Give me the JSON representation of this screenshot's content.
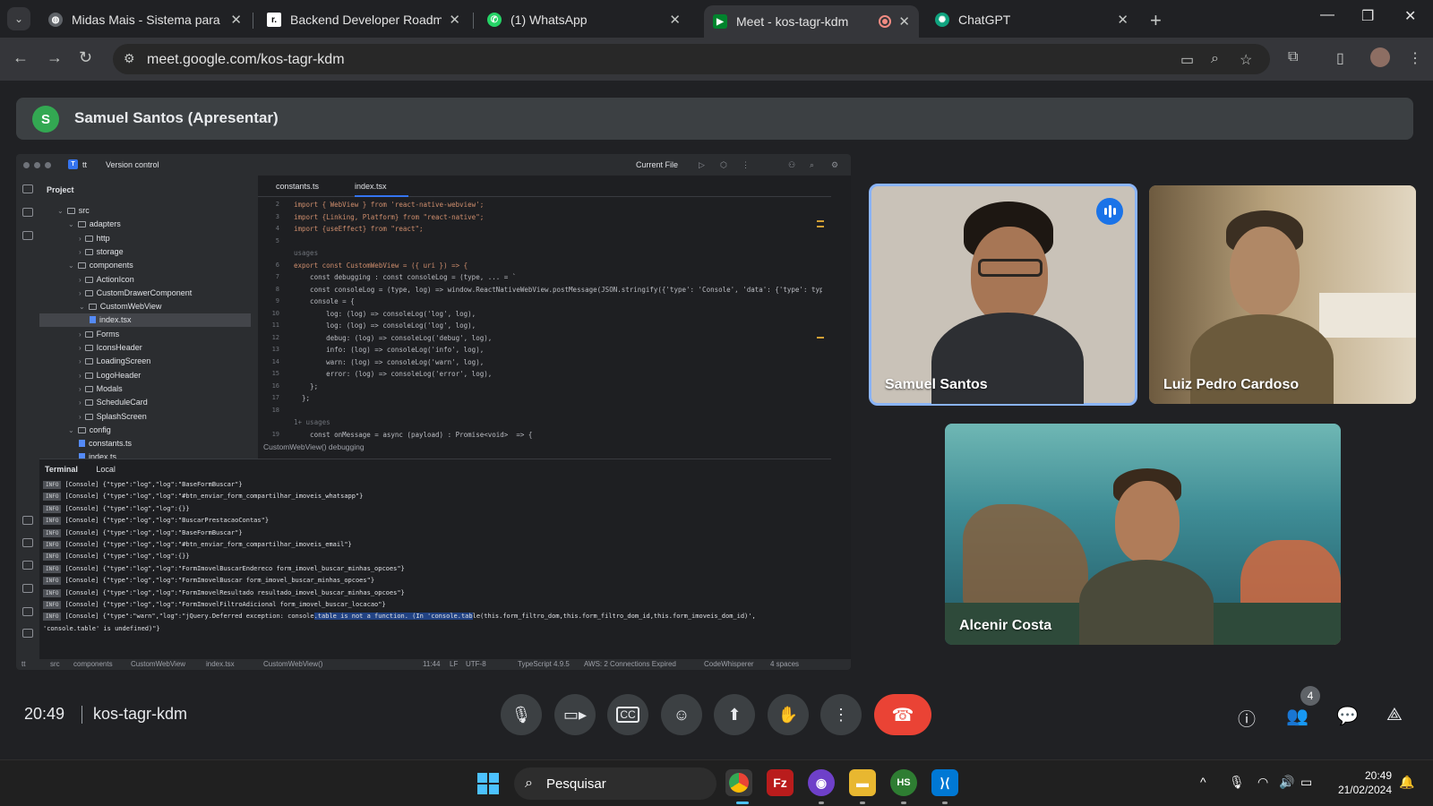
{
  "browser": {
    "tabs": [
      {
        "title": "Midas Mais - Sistema para Gere",
        "active": false
      },
      {
        "title": "Backend Developer Roadmap: W",
        "active": false
      },
      {
        "title": "(1) WhatsApp",
        "active": false
      },
      {
        "title": "Meet - kos-tagr-kdm",
        "active": true
      },
      {
        "title": "ChatGPT",
        "active": false
      }
    ],
    "url": "meet.google.com/kos-tagr-kdm"
  },
  "meet": {
    "presenter": {
      "initial": "S",
      "label": "Samuel Santos (Apresentar)"
    },
    "participants": [
      {
        "name": "Samuel Santos",
        "speaking": true
      },
      {
        "name": "Luiz Pedro Cardoso",
        "speaking": false
      },
      {
        "name": "Alcenir Costa",
        "speaking": false
      }
    ],
    "time": "20:49",
    "code": "kos-tagr-kdm",
    "participant_count": "4"
  },
  "ide": {
    "project_name": "tt",
    "vcs": "Version control",
    "run_config": "Current File",
    "project_label": "Project",
    "tree": [
      {
        "label": "src",
        "type": "folder",
        "depth": 0,
        "open": true
      },
      {
        "label": "adapters",
        "type": "folder",
        "depth": 1,
        "open": true
      },
      {
        "label": "http",
        "type": "folder",
        "depth": 2,
        "open": false
      },
      {
        "label": "storage",
        "type": "folder",
        "depth": 2,
        "open": false
      },
      {
        "label": "components",
        "type": "folder",
        "depth": 1,
        "open": true
      },
      {
        "label": "ActionIcon",
        "type": "folder",
        "depth": 2,
        "open": false
      },
      {
        "label": "CustomDrawerComponent",
        "type": "folder",
        "depth": 2,
        "open": false
      },
      {
        "label": "CustomWebView",
        "type": "folder",
        "depth": 2,
        "open": true
      },
      {
        "label": "index.tsx",
        "type": "file",
        "depth": 3,
        "selected": true
      },
      {
        "label": "Forms",
        "type": "folder",
        "depth": 2,
        "open": false
      },
      {
        "label": "IconsHeader",
        "type": "folder",
        "depth": 2,
        "open": false
      },
      {
        "label": "LoadingScreen",
        "type": "folder",
        "depth": 2,
        "open": false
      },
      {
        "label": "LogoHeader",
        "type": "folder",
        "depth": 2,
        "open": false
      },
      {
        "label": "Modals",
        "type": "folder",
        "depth": 2,
        "open": false
      },
      {
        "label": "ScheduleCard",
        "type": "folder",
        "depth": 2,
        "open": false
      },
      {
        "label": "SplashScreen",
        "type": "folder",
        "depth": 2,
        "open": false
      },
      {
        "label": "config",
        "type": "folder",
        "depth": 1,
        "open": true
      },
      {
        "label": "constants.ts",
        "type": "file",
        "depth": 2
      },
      {
        "label": "index.ts",
        "type": "file",
        "depth": 2
      }
    ],
    "editor_tabs": [
      "constants.ts",
      "index.tsx"
    ],
    "line_numbers": [
      "2",
      "3",
      "4",
      "5",
      "",
      "6",
      "7",
      "8",
      "9",
      "10",
      "11",
      "12",
      "13",
      "14",
      "15",
      "16",
      "17",
      "18",
      "",
      "19"
    ],
    "code_lines": [
      "import { WebView } from 'react-native-webview';",
      "import {Linking, Platform} from \"react-native\";",
      "import {useEffect} from \"react\";",
      "",
      "usages",
      "export const CustomWebView = ({ uri }) => {",
      "    const debugging : const consoleLog = (type, ... = `",
      "    const consoleLog = (type, log) => window.ReactNativeWebView.postMessage(JSON.stringify({'type': 'Console', 'data': {'type': type,",
      "    console = {",
      "        log: (log) => consoleLog('log', log),",
      "        log: (log) => consoleLog('log', log),",
      "        debug: (log) => consoleLog('debug', log),",
      "        info: (log) => consoleLog('info', log),",
      "        warn: (log) => consoleLog('warn', log),",
      "        error: (log) => consoleLog('error', log),",
      "    };",
      "  };",
      "",
      "1+ usages",
      "    const onMessage = async (payload) : Promise<void>  => {"
    ],
    "breadcrumbs": "CustomWebView()   debugging",
    "terminal_tabs": [
      "Terminal",
      "Local"
    ],
    "log_lines": [
      "[Console] {\"type\":\"log\",\"log\":\"BaseFormBuscar\"}",
      "[Console] {\"type\":\"log\",\"log\":\"#btn_enviar_form_compartilhar_imoveis_whatsapp\"}",
      "[Console] {\"type\":\"log\",\"log\":{}}",
      "[Console] {\"type\":\"log\",\"log\":\"BuscarPrestacaoContas\"}",
      "[Console] {\"type\":\"log\",\"log\":\"BaseFormBuscar\"}",
      "[Console] {\"type\":\"log\",\"log\":\"#btn_enviar_form_compartilhar_imoveis_email\"}",
      "[Console] {\"type\":\"log\",\"log\":{}}",
      "[Console] {\"type\":\"log\",\"log\":\"FormImovelBuscarEndereco form_imovel_buscar_minhas_opcoes\"}",
      "[Console] {\"type\":\"log\",\"log\":\"FormImovelBuscar form_imovel_buscar_minhas_opcoes\"}",
      "[Console] {\"type\":\"log\",\"log\":\"FormImovelResultado resultado_imovel_buscar_minhas_opcoes\"}",
      "[Console] {\"type\":\"log\",\"log\":\"FormImovelFiltroAdicional  form_imovel_buscar_locacao\"}"
    ],
    "log_badge": "INFO",
    "warn_line_pre": "[Console] {\"type\":\"warn\",\"log\":\"jQuery.Deferred exception: console",
    "warn_line_hl": ".table is not a function. (In 'console.tab",
    "warn_line_post": "le(this.form_filtro_dom,this.form_filtro_dom_id,this.form_imoveis_dom_id)',",
    "warn_line_2": "'console.table' is undefined)\"}",
    "status_path": [
      "tt",
      "src",
      "components",
      "CustomWebView",
      "index.tsx",
      "CustomWebView()"
    ],
    "status_right": [
      "11:44",
      "LF",
      "UTF-8",
      "TypeScript 4.9.5",
      "AWS: 2 Connections Expired",
      "CodeWhisperer",
      "4 spaces"
    ]
  },
  "taskbar": {
    "search_placeholder": "Pesquisar",
    "time": "20:49",
    "date": "21/02/2024"
  },
  "colors": {
    "meet_bg": "#202124",
    "end_call": "#ea4335",
    "speaking_outline": "#8ab4f8",
    "presenter_avatar": "#33a852"
  }
}
